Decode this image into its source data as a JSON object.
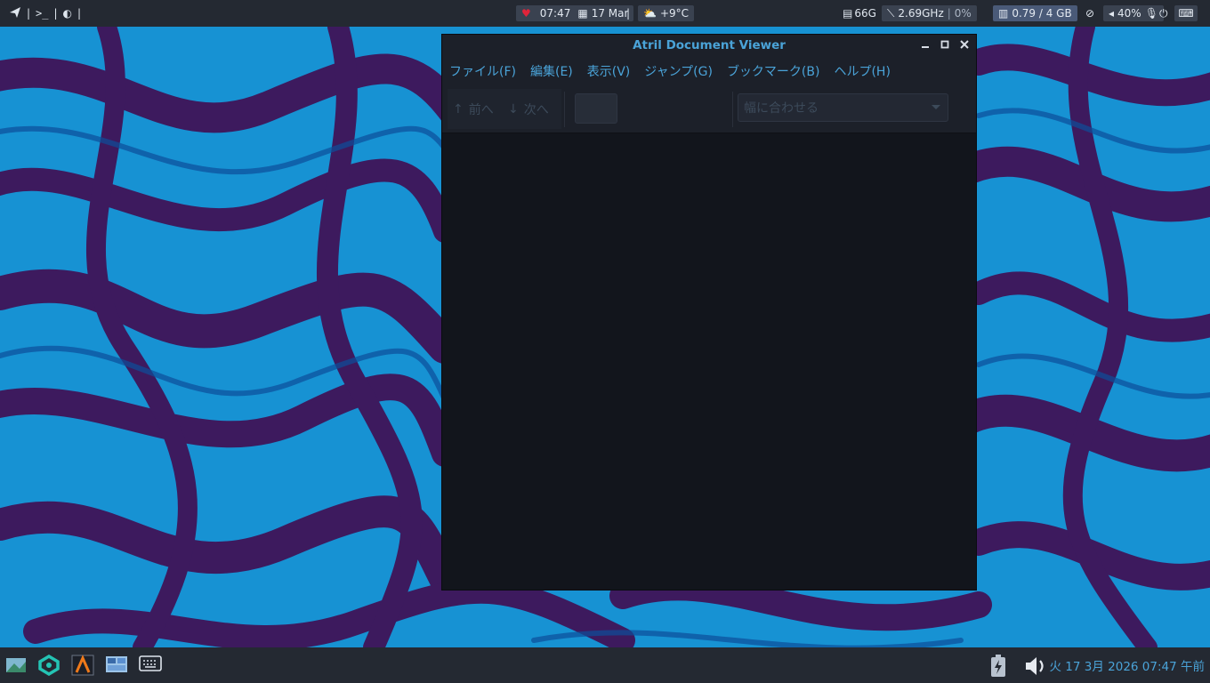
{
  "topbar": {
    "left_separators": [
      "|",
      "|",
      "|"
    ],
    "time": "07:47",
    "date": "17 Mar",
    "divider": "|",
    "weather": "+9°C",
    "disk": "66G",
    "cpu_freq": "2.69GHz",
    "cpu_sep": "|",
    "cpu_usage": "0%",
    "memory": "0.79 / 4 GB",
    "volume": "40%"
  },
  "window": {
    "title": "Atril Document Viewer",
    "menu": [
      {
        "label": "ファイル(F)"
      },
      {
        "label": "編集(E)"
      },
      {
        "label": "表示(V)"
      },
      {
        "label": "ジャンプ(G)"
      },
      {
        "label": "ブックマーク(B)"
      },
      {
        "label": "ヘルプ(H)"
      }
    ],
    "toolbar": {
      "prev_label": "前へ",
      "next_label": "次へ",
      "page_value": "",
      "zoom_value": "幅に合わせる"
    }
  },
  "bottombar": {
    "clock": "火 17  3月 2026 07:47 午前"
  },
  "colors": {
    "accent": "#4aa3d8",
    "panel": "#242932",
    "window_bg": "#12151c"
  }
}
